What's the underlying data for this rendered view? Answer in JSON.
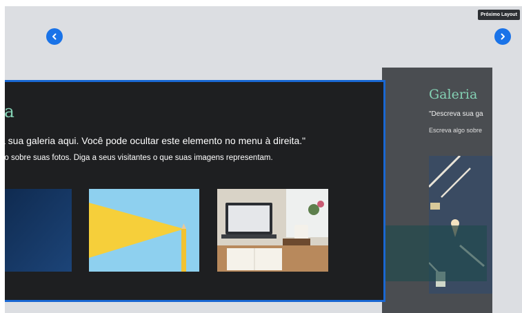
{
  "tooltip": {
    "next_layout": "Próximo Layout"
  },
  "nav": {
    "prev_icon": "chevron-left-icon",
    "next_icon": "chevron-right-icon"
  },
  "current_slide": {
    "title": "ia",
    "description": "a sua galeria aqui. Você pode ocultar este elemento no menu à direita.\"",
    "subtext": "go sobre suas fotos. Diga a seus visitantes o que suas imagens representam."
  },
  "next_slide": {
    "title": "Galeria",
    "description": "\"Descreva sua ga",
    "subtext": "Escreva algo sobre"
  },
  "colors": {
    "accent": "#1a73e8",
    "title_green": "#84d1b4",
    "slide_bg": "#1e1f21",
    "stage_bg": "#dcdee2"
  }
}
